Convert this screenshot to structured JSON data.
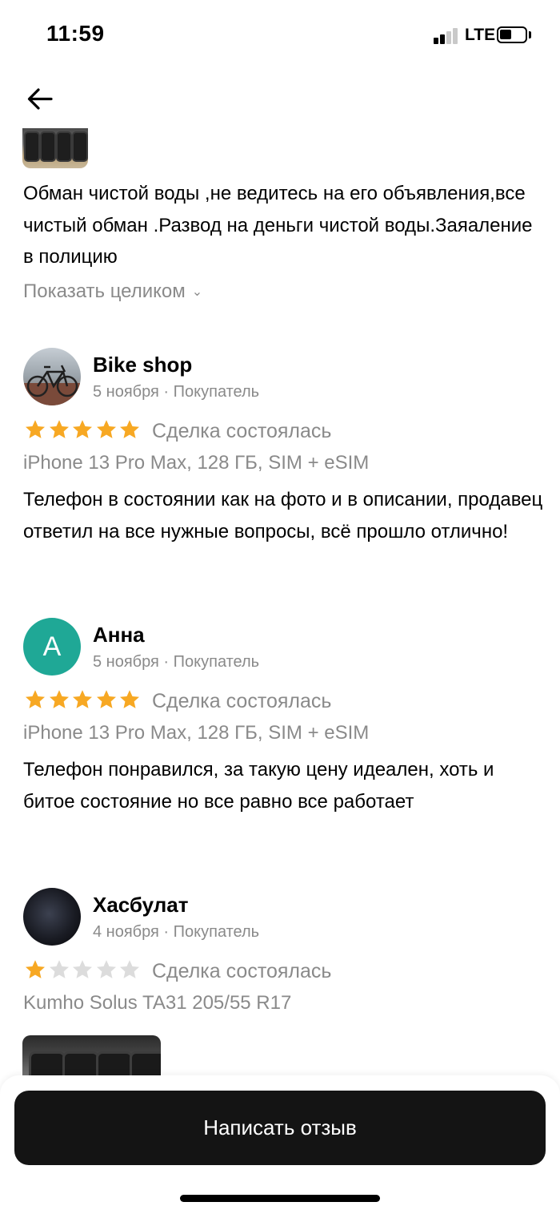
{
  "status_bar": {
    "time": "11:59",
    "network": "LTE"
  },
  "nav": {
    "back_icon": "arrow-left-icon"
  },
  "top_review": {
    "text": "Обман чистой воды ,не ведитесь  на его объявления,все чистый обман .Развод на деньги чистой воды.Заяаление в полицию",
    "show_more_label": "Показать целиком"
  },
  "reviews": [
    {
      "name": "Bike shop",
      "meta": "5 ноября · Покупатель",
      "rating": 5,
      "status": "Сделка состоялась",
      "product": "iPhone 13 Pro Max, 128 ГБ, SIM + eSIM",
      "text": "Телефон в состоянии как на фото и в описании, продавец ответил на все нужные вопросы, всё прошло отлично!"
    },
    {
      "name": "Анна",
      "avatar_letter": "А",
      "meta": "5 ноября · Покупатель",
      "rating": 5,
      "status": "Сделка состоялась",
      "product": "iPhone 13 Pro Max, 128 ГБ, SIM + eSIM",
      "text": "Телефон понравился, за такую цену идеален, хоть и битое состояние но все равно все работает"
    },
    {
      "name": "Хасбулат",
      "meta": "4 ноября · Покупатель",
      "rating": 1,
      "status": "Сделка состоялась",
      "product": "Kumho Solus TA31 205/55 R17"
    }
  ],
  "cta": {
    "label": "Написать отзыв"
  },
  "colors": {
    "star_filled": "#f7a823",
    "star_empty": "#dcdcdc",
    "avatar_accent": "#1fa896",
    "button_bg": "#141414"
  }
}
